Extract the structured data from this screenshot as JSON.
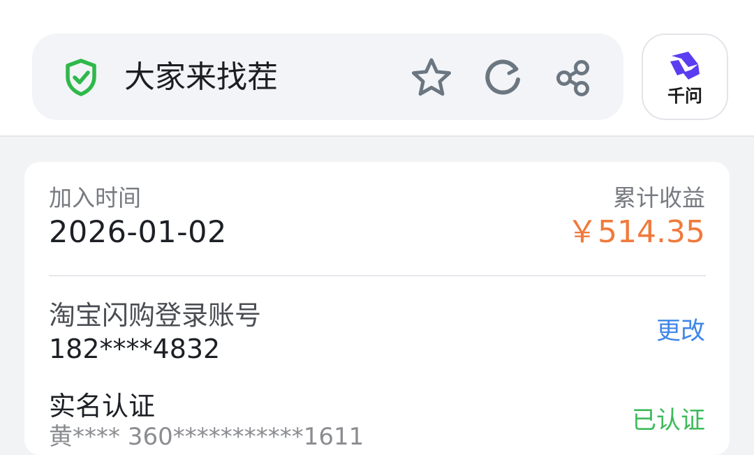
{
  "browser": {
    "page_title": "大家来找茬",
    "ai_assistant_label": "千问",
    "icons": {
      "security": "shield-check-icon",
      "bookmark": "star-icon",
      "reload": "reload-icon",
      "share": "share-icon",
      "ai": "qianwen-logo-icon"
    },
    "colors": {
      "shield": "#2fb84a",
      "ai_logo": "#5a3df0"
    }
  },
  "card": {
    "join_time_label": "加入时间",
    "join_date": "2026-01-02",
    "earnings_label": "累计收益",
    "earnings_value": "￥514.35",
    "account_label": "淘宝闪购登录账号",
    "account_value": "182****4832",
    "change_label": "更改",
    "verify_label": "实名认证",
    "verify_detail": "黄**** 360***********1611",
    "verify_status": "已认证",
    "colors": {
      "earnings": "#f07a3c",
      "link": "#3f87e8",
      "verified": "#3dba5a"
    }
  }
}
